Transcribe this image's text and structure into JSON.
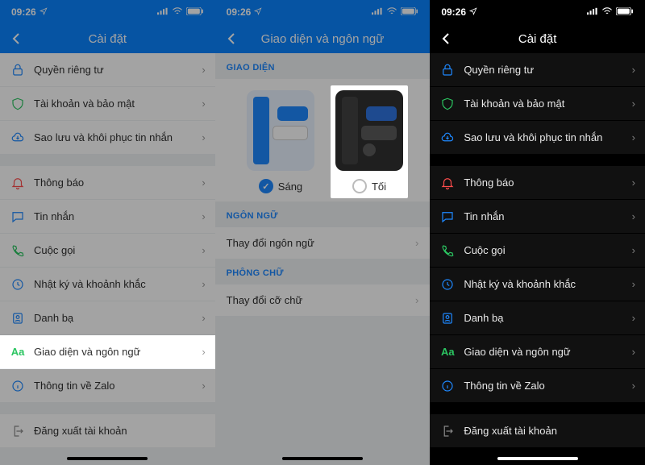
{
  "status": {
    "time": "09:26",
    "loc_icon": "loc",
    "signal": "sig",
    "wifi": "wifi",
    "battery": "batt"
  },
  "p1": {
    "title": "Cài đặt",
    "rows": [
      {
        "icon": "lock",
        "label": "Quyền riêng tư"
      },
      {
        "icon": "shield",
        "label": "Tài khoản và bảo mật"
      },
      {
        "icon": "cloud",
        "label": "Sao lưu và khôi phục tin nhắn"
      },
      {
        "gap": true
      },
      {
        "icon": "bell",
        "label": "Thông báo"
      },
      {
        "icon": "chat",
        "label": "Tin nhắn"
      },
      {
        "icon": "phone",
        "label": "Cuộc gọi"
      },
      {
        "icon": "clock",
        "label": "Nhật ký và khoảnh khắc"
      },
      {
        "icon": "contacts",
        "label": "Danh bạ"
      },
      {
        "icon": "aa",
        "label": "Giao diện và ngôn ngữ",
        "hl": true
      },
      {
        "icon": "info",
        "label": "Thông tin về Zalo"
      },
      {
        "gap": true
      },
      {
        "icon": "logout",
        "label": "Đăng xuất tài khoản",
        "nochev": true
      }
    ]
  },
  "p2": {
    "title": "Giao diện và ngôn ngữ",
    "sec_interface": "GIAO DIỆN",
    "theme_light": "Sáng",
    "theme_dark": "Tối",
    "sec_language": "NGÔN NGỮ",
    "change_language": "Thay đổi ngôn ngữ",
    "sec_font": "PHÔNG CHỮ",
    "change_font": "Thay đổi cỡ chữ"
  },
  "p3": {
    "title": "Cài đặt",
    "rows": [
      {
        "icon": "lock",
        "label": "Quyền riêng tư"
      },
      {
        "icon": "shield",
        "label": "Tài khoản và bảo mật"
      },
      {
        "icon": "cloud",
        "label": "Sao lưu và khôi phục tin nhắn"
      },
      {
        "gap": true
      },
      {
        "icon": "bell",
        "label": "Thông báo"
      },
      {
        "icon": "chat",
        "label": "Tin nhắn"
      },
      {
        "icon": "phone",
        "label": "Cuộc gọi"
      },
      {
        "icon": "clock",
        "label": "Nhật ký và khoảnh khắc"
      },
      {
        "icon": "contacts",
        "label": "Danh bạ"
      },
      {
        "icon": "aa",
        "label": "Giao diện và ngôn ngữ"
      },
      {
        "icon": "info",
        "label": "Thông tin về Zalo"
      },
      {
        "gap": true
      },
      {
        "icon": "logout",
        "label": "Đăng xuất tài khoản",
        "nochev": true
      }
    ]
  }
}
